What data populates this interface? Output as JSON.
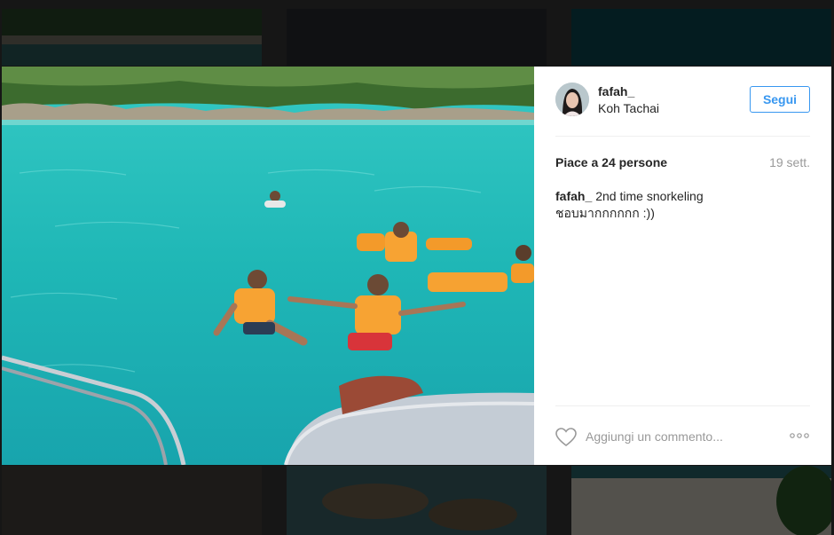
{
  "post": {
    "username": "fafah_",
    "location": "Koh Tachai",
    "follow_label": "Segui",
    "likes_text": "Piace a 24 persone",
    "date": "19 sett.",
    "caption_user": "fafah_",
    "caption_line1": "2nd time snorkeling",
    "caption_line2": "ชอบมากกกกกก :))",
    "comment_placeholder": "Aggiungi un commento...",
    "more_icon": "ellipsis-icon",
    "like_icon": "heart-icon"
  },
  "colors": {
    "accent": "#3897f0",
    "text": "#262626",
    "muted": "#999999",
    "divider": "#efefef",
    "backdrop": "#3a3a3a"
  }
}
